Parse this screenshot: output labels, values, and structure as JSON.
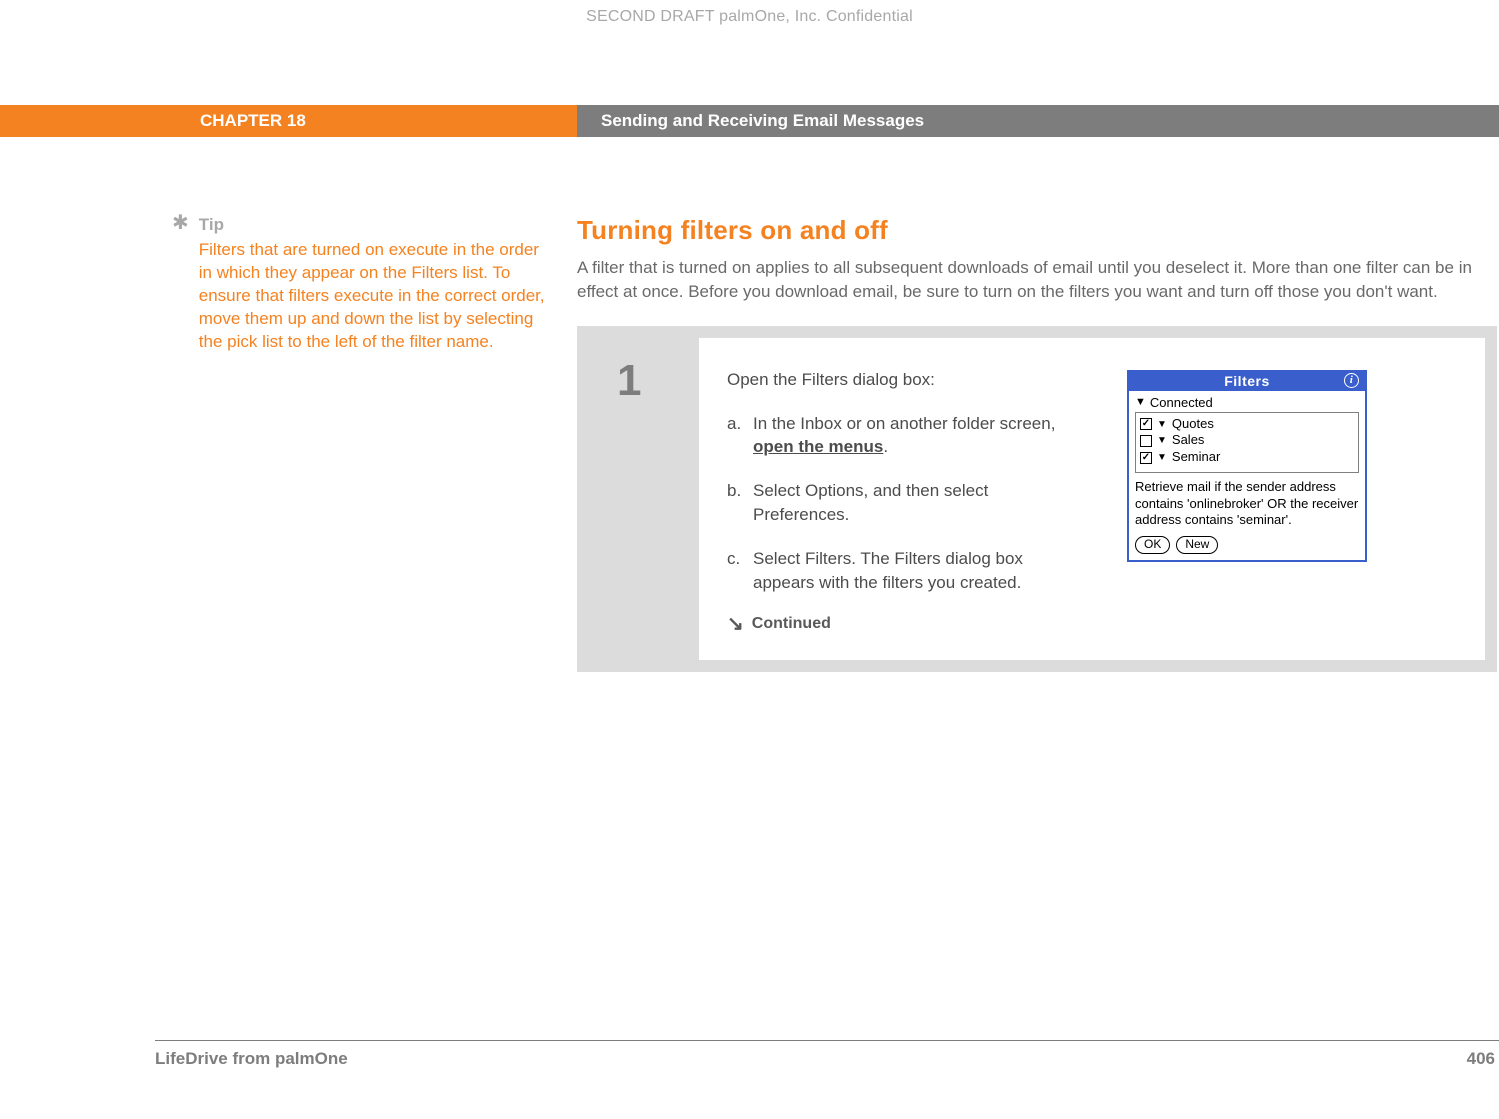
{
  "confidential": "SECOND DRAFT palmOne, Inc.  Confidential",
  "header": {
    "chapter": "CHAPTER 18",
    "title": "Sending and Receiving Email Messages"
  },
  "tip": {
    "heading": "Tip",
    "text": "Filters that are turned on execute in the order in which they appear on the Filters list. To ensure that filters execute in the correct order, move them up and down the list by selecting the pick list to the left of the filter name."
  },
  "section": {
    "heading": "Turning filters on and off",
    "paragraph": "A filter that is turned on applies to all subsequent downloads of email until you deselect it. More than one filter can be in effect at once. Before you download email, be sure to turn on the filters you want and turn off those you don't want."
  },
  "step": {
    "number": "1",
    "intro": "Open the Filters dialog box:",
    "items": {
      "a": {
        "letter": "a.",
        "pre": "In the Inbox or on another folder screen, ",
        "link": "open the menus",
        "post": "."
      },
      "b": {
        "letter": "b.",
        "text": "Select Options, and then select Preferences."
      },
      "c": {
        "letter": "c.",
        "text": "Select Filters. The Filters dialog box appears with the filters you created."
      }
    },
    "continued": "Continued"
  },
  "palm": {
    "title": "Filters",
    "connected": "Connected",
    "filters": [
      {
        "checked": true,
        "name": "Quotes"
      },
      {
        "checked": false,
        "name": "Sales"
      },
      {
        "checked": true,
        "name": "Seminar"
      }
    ],
    "description": "Retrieve mail if the sender address contains 'onlinebroker' OR the receiver address contains 'seminar'.",
    "buttons": {
      "ok": "OK",
      "new": "New"
    }
  },
  "footer": {
    "product": "LifeDrive from palmOne",
    "page": "406"
  }
}
